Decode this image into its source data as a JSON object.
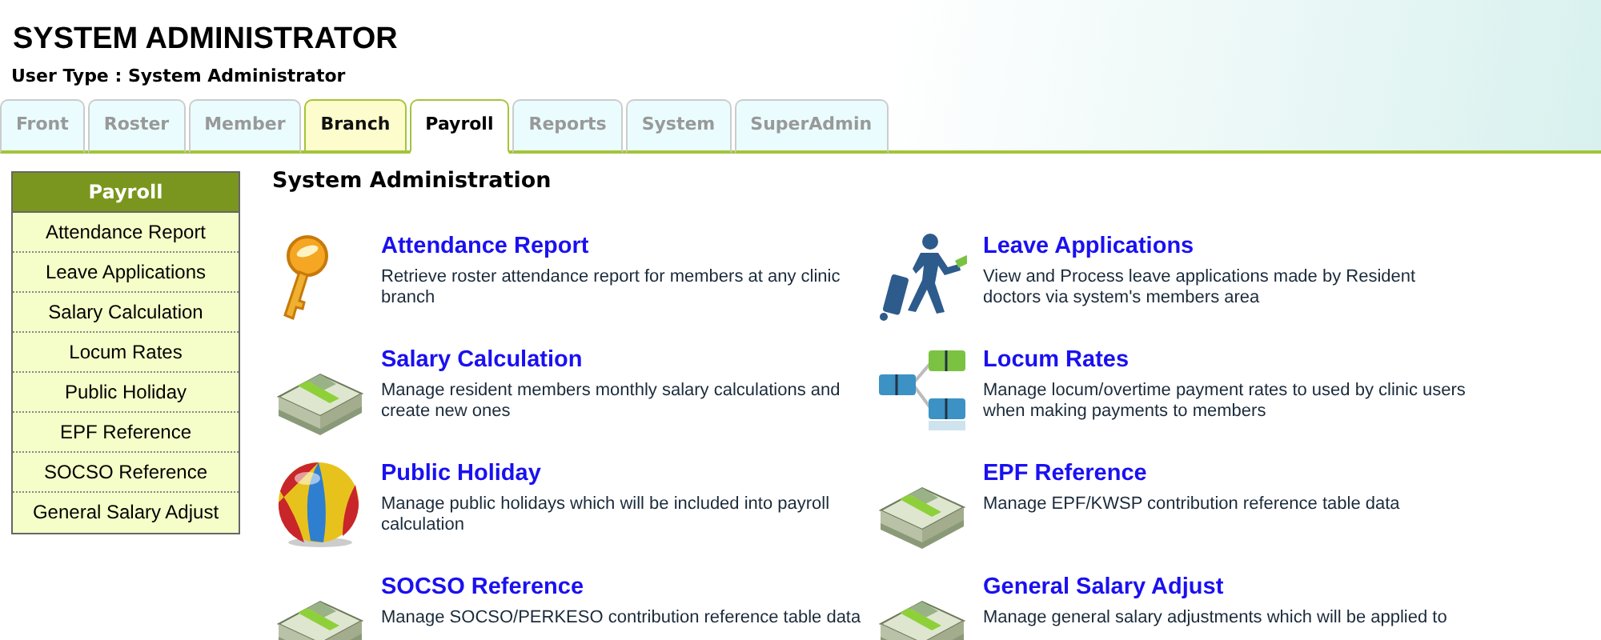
{
  "header": {
    "title": "SYSTEM ADMINISTRATOR",
    "user_type": "User Type : System Administrator"
  },
  "tabs": [
    {
      "label": "Front",
      "selected": false,
      "highlighted": false
    },
    {
      "label": "Roster",
      "selected": false,
      "highlighted": false
    },
    {
      "label": "Member",
      "selected": false,
      "highlighted": false
    },
    {
      "label": "Branch",
      "selected": false,
      "highlighted": true
    },
    {
      "label": "Payroll",
      "selected": true,
      "highlighted": false
    },
    {
      "label": "Reports",
      "selected": false,
      "highlighted": false
    },
    {
      "label": "System",
      "selected": false,
      "highlighted": false
    },
    {
      "label": "SuperAdmin",
      "selected": false,
      "highlighted": false
    }
  ],
  "sidebar": {
    "title": "Payroll",
    "items": [
      "Attendance Report",
      "Leave Applications",
      "Salary Calculation",
      "Locum Rates",
      "Public Holiday",
      "EPF Reference",
      "SOCSO Reference",
      "General Salary Adjust"
    ]
  },
  "main": {
    "heading": "System Administration",
    "items": [
      {
        "kind": "key",
        "title": "Attendance Report",
        "description": "Retrieve roster attendance report for members at any clinic branch"
      },
      {
        "kind": "traveler",
        "title": "Leave Applications",
        "description": "View and Process leave applications made by Resident doctors via system's members area"
      },
      {
        "kind": "money",
        "title": "Salary Calculation",
        "description": "Manage resident members monthly salary calculations and create new ones"
      },
      {
        "kind": "tree",
        "title": "Locum Rates",
        "description": "Manage locum/overtime payment rates to used by clinic users when making payments to members"
      },
      {
        "kind": "ball",
        "title": "Public Holiday",
        "description": "Manage public holidays which will be included into payroll calculation"
      },
      {
        "kind": "money",
        "title": "EPF Reference",
        "description": "Manage EPF/KWSP contribution reference table data"
      },
      {
        "kind": "money",
        "title": "SOCSO Reference",
        "description": "Manage SOCSO/PERKESO contribution reference table data"
      },
      {
        "kind": "money",
        "title": "General Salary Adjust",
        "description": "Manage general salary adjustments which will be applied to"
      }
    ]
  }
}
